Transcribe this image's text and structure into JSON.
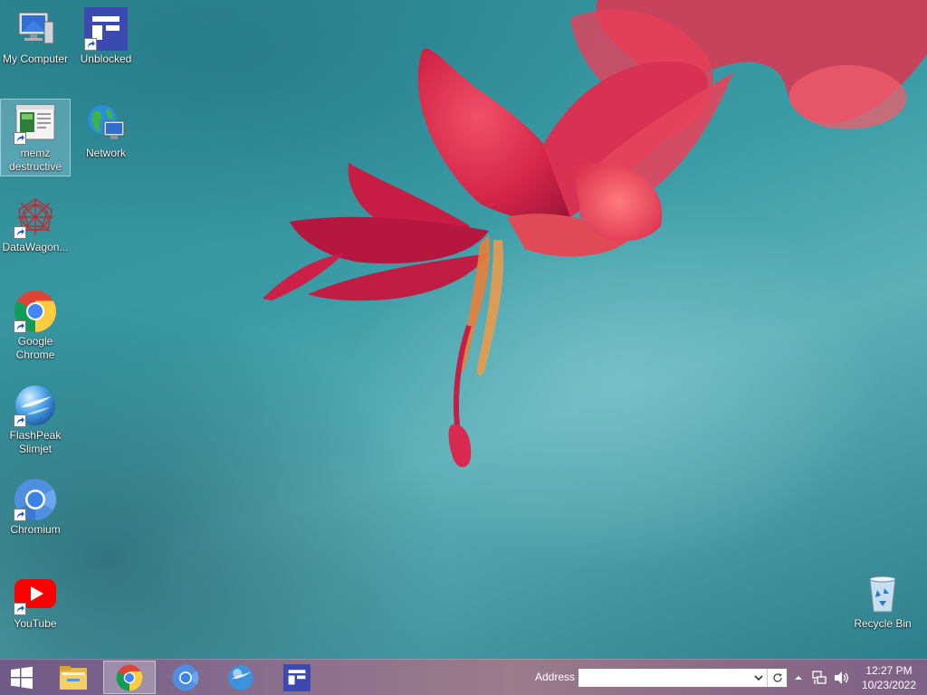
{
  "desktop": {
    "icons": [
      {
        "label": "My Computer",
        "icon": "computer-icon"
      },
      {
        "label": "Unblocked",
        "icon": "unblocked-app-icon"
      },
      {
        "label": "memz destructive",
        "icon": "memz-window-icon"
      },
      {
        "label": "Network",
        "icon": "network-globe-icon"
      },
      {
        "label": "DataWagon...",
        "icon": "datawagon-icon"
      },
      {
        "label": "Google Chrome",
        "icon": "chrome-icon"
      },
      {
        "label": "FlashPeak Slimjet",
        "icon": "slimjet-icon"
      },
      {
        "label": "Chromium",
        "icon": "chromium-icon"
      },
      {
        "label": "YouTube",
        "icon": "youtube-icon"
      },
      {
        "label": "Recycle Bin",
        "icon": "recycle-bin-icon"
      }
    ]
  },
  "taskbar": {
    "pinned": [
      {
        "name": "file-explorer",
        "icon": "folder-icon"
      },
      {
        "name": "google-chrome",
        "icon": "chrome-icon",
        "active": true
      },
      {
        "name": "chromium",
        "icon": "chromium-icon"
      },
      {
        "name": "slimjet",
        "icon": "slimjet-icon"
      },
      {
        "name": "unblocked",
        "icon": "unblocked-app-icon"
      }
    ],
    "address": {
      "label": "Address",
      "value": "",
      "placeholder": ""
    },
    "tray_icons": [
      "chevron-up-icon",
      "network-icon",
      "volume-icon"
    ],
    "clock": {
      "time": "12:27 PM",
      "date": "10/23/2022"
    }
  },
  "colors": {
    "taskbar": "#8a6f8d",
    "desktop_teal": "#3a9ba5",
    "flower": "#d42a4e"
  }
}
